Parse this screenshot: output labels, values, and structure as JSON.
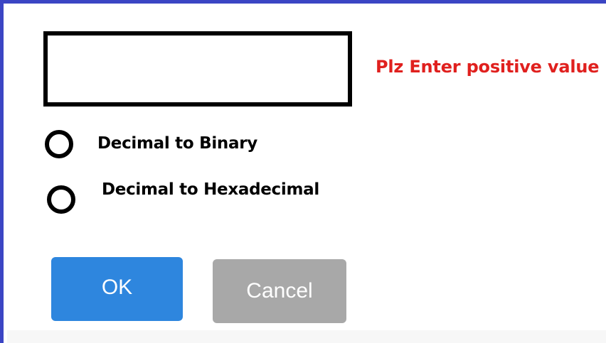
{
  "input": {
    "value": "",
    "placeholder": ""
  },
  "validation": {
    "message": "Plz Enter positive value",
    "color": "#e0201e"
  },
  "options": [
    {
      "label": "Decimal to Binary",
      "selected": false
    },
    {
      "label": "Decimal to Hexadecimal",
      "selected": false
    }
  ],
  "buttons": {
    "ok_label": "OK",
    "cancel_label": "Cancel",
    "ok_color": "#2e86de",
    "cancel_color": "#a8a8a8"
  },
  "frame_color": "#3b45c4"
}
